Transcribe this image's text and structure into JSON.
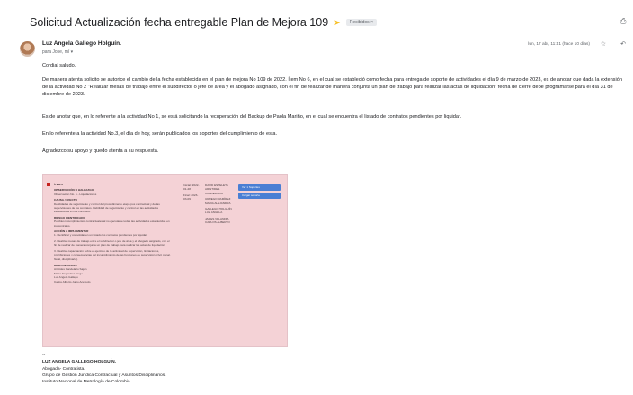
{
  "subject": "Solicitud Actualización fecha entregable Plan de Mejora 109",
  "label": "Recibidos ×",
  "sender_name": "Luz Angela Gallego Holguín.",
  "to_line": "para Jose, mí ▾",
  "date": "lun, 17 abr, 11:41 (hace 10 días)",
  "greeting": "Cordial saludo.",
  "para1": "De manera atenta solicito se autorice el cambio de la fecha establecida en el plan de mejora No 109 de 2022. Ítem No 6, en el cual se estableció como fecha para entrega de soporte de actividades el día 9 de marzo de 2023, es de anotar que dada la extensión de la actividad No 2 \"Realizar mesas de trabajo entre el subdirector o jefe de área y el abogado asignado, con el fin de realizar de manera conjunta un plan de trabajo para realizar las actas de liquidación\" fecha de cierre debe programarse para el día 31 de diciembre de 2023.",
  "para2": "Es de anotar que, en lo referente a la  actividad No 1, se está solicitando la recuperación del Backup de Paola Mariño, en el cual se encuentra el listado de contratos pendientes por liquidar.",
  "para3": "En lo referente a la actividad No.3, el día de hoy, serán publicados los soportes del cumplimiento de esta.",
  "para4": "Agradezco su apoyo y quedo atenta a su respuesta.",
  "doc": {
    "item": "ÍTEM 6",
    "obs_title": "OBSERVACIÓN O HALLAZGO",
    "obs_text": "Observación No. 6 - Liquidaciones",
    "causa_title": "CAUSA / EFECTO",
    "causa_text": "Debilidades de seguimiento y control del procedimiento etapa pos contractual y de las supervisiones de los contratos. Debilidad de seguimiento y control en las actividades establecidas en los contratos.",
    "riesgo_title": "RIESGO IDENTIFICADO",
    "riesgo_text": "Posibles incumplimientos contractuales al no ejecutarse todas las actividades establecidas en los contratos.",
    "accion_title": "ACCIÓN A IMPLEMENTAR",
    "accion_1": "1. Identificar y consolidar en un listado los contratos pendientes por liquidar.",
    "accion_2": "2. Realizar mesas de trabajo entre el subdirector o jefe de área y el abogado asignado, con el fin de realizar de manera conjunta un plan de trabajo para realizar las actas de liquidación.",
    "accion_3": "3. Realizar capacitación sobre el ejercicio de la actividad de supervisión, limitaciones, prohibiciones y consecuencias del incumplimiento de las funciones de supervisión (civil, penal, fiscal, disciplinario).",
    "resp_title": "RESPONSABLES",
    "resp_1": "Aristides Candelario Sajon",
    "resp_2": "María Alejandra Urrego",
    "resp_3": "Luz Angela Gallego",
    "resp_4": "Carlos Alberto Junio Acevedo",
    "dates_1": "Inicial: 2022-01-28",
    "dates_2": "Final: 2023-03-09",
    "names_1": "DAVID ESPELETA ARISTIDES CANDELARIO",
    "names_2": "URREGO RAMÍREZ MARÍA ALEJANDRA",
    "names_3": "GALLEGO HOLGUÍN LUZ ÁNGELA",
    "names_4": "JAMES VELANDIA CARLOS ALBERTO",
    "btn_1": "Ver 1 Soportes",
    "btn_2": "Cargar soporte"
  },
  "sig_dash": "--",
  "sig_name": "LUZ ANGELA GALLEGO HOLGUÍN.",
  "sig_role": "Abogada- Contratista.",
  "sig_group": "Grupo de Gestión Jurídica Contractual y Asuntos Disciplinarios.",
  "sig_inst": "Instituto Nacional de Metrología de Colombia"
}
